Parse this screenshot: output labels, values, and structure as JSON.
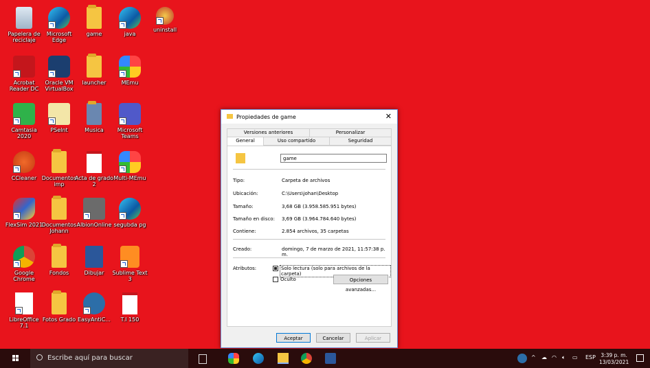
{
  "desktop": {
    "icons": [
      {
        "label": "Papelera de reciclaje"
      },
      {
        "label": "Microsoft Edge"
      },
      {
        "label": "game"
      },
      {
        "label": "java"
      },
      {
        "label": "uninstall"
      },
      {
        "label": "Acrobat Reader DC"
      },
      {
        "label": "Oracle VM VirtualBox"
      },
      {
        "label": "launcher"
      },
      {
        "label": "MEmu"
      },
      {
        "label": "Camtasia 2020"
      },
      {
        "label": "PSeInt"
      },
      {
        "label": "Musica"
      },
      {
        "label": "Microsoft Teams"
      },
      {
        "label": "CCleaner"
      },
      {
        "label": "Documentos imp"
      },
      {
        "label": "Acta de grado 2"
      },
      {
        "label": "Multi-MEmu"
      },
      {
        "label": "FlexSim 2021"
      },
      {
        "label": "Documentos Johann"
      },
      {
        "label": "AlbionOnline"
      },
      {
        "label": "segubda pg"
      },
      {
        "label": "Google Chrome"
      },
      {
        "label": "Fondos"
      },
      {
        "label": "Dibujar"
      },
      {
        "label": "Sublime Text 3"
      },
      {
        "label": "LibreOffice 7.1"
      },
      {
        "label": "Fotos Grado"
      },
      {
        "label": "EasyAntiC..."
      },
      {
        "label": "T.I 150"
      }
    ]
  },
  "dialog": {
    "title": "Propiedades de game",
    "tabs_top": [
      "Versiones anteriores",
      "Personalizar"
    ],
    "tabs_bottom": [
      "General",
      "Uso compartido",
      "Seguridad"
    ],
    "name_value": "game",
    "rows": [
      {
        "label": "Tipo:",
        "value": "Carpeta de archivos"
      },
      {
        "label": "Ubicación:",
        "value": "C:\\Users\\johan\\Desktop"
      },
      {
        "label": "Tamaño:",
        "value": "3,68 GB (3.958.585.951 bytes)"
      },
      {
        "label": "Tamaño en disco:",
        "value": "3,69 GB (3.964.784.640 bytes)"
      },
      {
        "label": "Contiene:",
        "value": "2.854 archivos, 35 carpetas"
      },
      {
        "label": "Creado:",
        "value": "domingo, 7 de marzo de 2021, 11:57:38 p. m."
      }
    ],
    "attributes_label": "Atributos:",
    "readonly_label": "Solo lectura (solo para archivos de la carpeta)",
    "hidden_label": "Oculto",
    "advanced_button": "Opciones avanzadas...",
    "ok_button": "Aceptar",
    "cancel_button": "Cancelar",
    "apply_button": "Aplicar"
  },
  "taskbar": {
    "search_placeholder": "Escribe aquí para buscar",
    "language": "ESP",
    "time": "3:39 p. m.",
    "date": "13/03/2021"
  }
}
